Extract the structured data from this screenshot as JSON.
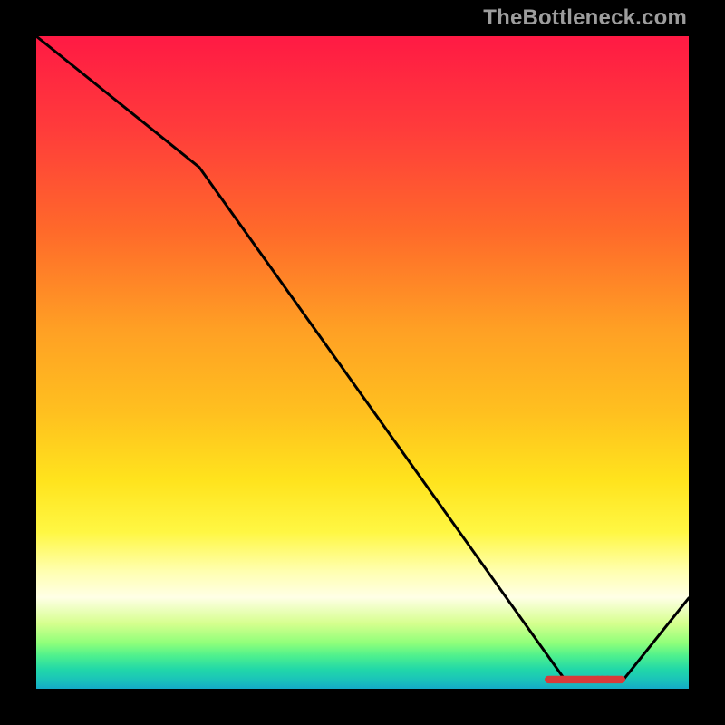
{
  "attribution": "TheBottleneck.com",
  "colors": {
    "frame": "#000000",
    "line": "#000000",
    "footer_marks": "#d83a3a",
    "attribution_text": "#9d9d9d"
  },
  "chart_data": {
    "type": "line",
    "title": "",
    "xlabel": "",
    "ylabel": "",
    "xlim": [
      0,
      100
    ],
    "ylim": [
      0,
      100
    ],
    "grid": false,
    "legend": false,
    "x": [
      0,
      25,
      81,
      90,
      100
    ],
    "values": [
      100,
      79.9,
      1.4,
      1.4,
      13.9
    ],
    "footer_segments_x": [
      [
        78.5,
        80.6
      ],
      [
        80.6,
        86.1
      ],
      [
        86.1,
        86.7
      ],
      [
        86.7,
        87.6
      ],
      [
        87.6,
        89.7
      ]
    ],
    "footer_y": 1.4
  }
}
